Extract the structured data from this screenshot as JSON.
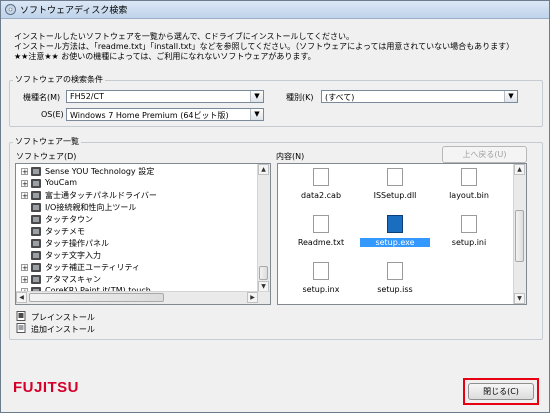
{
  "window": {
    "title": "ソフトウェアディスク検索"
  },
  "instructions": {
    "line1": "インストールしたいソフトウェアを一覧から選んで、Cドライブにインストールしてください。",
    "line2": "インストール方法は、「readme.txt」「install.txt」などを参照してください。（ソフトウェアによっては用意されていない場合もあります）",
    "line3_stars": "★★",
    "line3_text": "注意",
    "line3_stars2": "★★",
    "line3_rest": "お使いの機種によっては、ご利用になれないソフトウェアがあります。"
  },
  "search": {
    "group_label": "ソフトウェアの検索条件",
    "model_label": "機種名(M)",
    "model_value": "FH52/CT",
    "category_label": "種別(K)",
    "category_value": "(すべて)",
    "os_label": "OS(E)",
    "os_value": "Windows 7 Home Premium (64ビット版)"
  },
  "list": {
    "group_label": "ソフトウェア一覧",
    "software_label": "ソフトウェア(D)",
    "contents_label": "内容(N)",
    "up_button": "上へ戻る(U)",
    "tree": [
      {
        "label": "Sense YOU Technology 設定",
        "expandable": true
      },
      {
        "label": "YouCam",
        "expandable": true
      },
      {
        "label": "富士通タッチパネルドライバー",
        "expandable": true
      },
      {
        "label": "I/O接続親和性向上ツール",
        "expandable": false
      },
      {
        "label": "タッチタウン",
        "expandable": false
      },
      {
        "label": "タッチメモ",
        "expandable": false
      },
      {
        "label": "タッチ操作パネル",
        "expandable": false
      },
      {
        "label": "タッチ文字入力",
        "expandable": false
      },
      {
        "label": "タッチ補正ユーティリティ",
        "expandable": true
      },
      {
        "label": "アタマスキャン",
        "expandable": true
      },
      {
        "label": "CoreKR) Paint it(TM) touch",
        "expandable": true
      }
    ],
    "files": [
      {
        "name": "data2.cab",
        "icon": "cab-file-icon",
        "selected": false
      },
      {
        "name": "ISSetup.dll",
        "icon": "dll-file-icon",
        "selected": false
      },
      {
        "name": "layout.bin",
        "icon": "bin-file-icon",
        "selected": false
      },
      {
        "name": "Readme.txt",
        "icon": "text-file-icon",
        "selected": false
      },
      {
        "name": "setup.exe",
        "icon": "setup-exe-icon",
        "selected": true
      },
      {
        "name": "setup.ini",
        "icon": "ini-file-icon",
        "selected": false
      },
      {
        "name": "setup.inx",
        "icon": "inx-file-icon",
        "selected": false
      },
      {
        "name": "setup.iss",
        "icon": "iss-file-icon",
        "selected": false
      }
    ]
  },
  "legend": {
    "preinstall": "プレインストール",
    "addinstall": "追加インストール"
  },
  "footer": {
    "brand": "FUJITSU",
    "close_button": "閉じる(C)"
  },
  "colors": {
    "brand_red": "#d4002a",
    "highlight": "#e60012",
    "selection": "#3399ff"
  }
}
